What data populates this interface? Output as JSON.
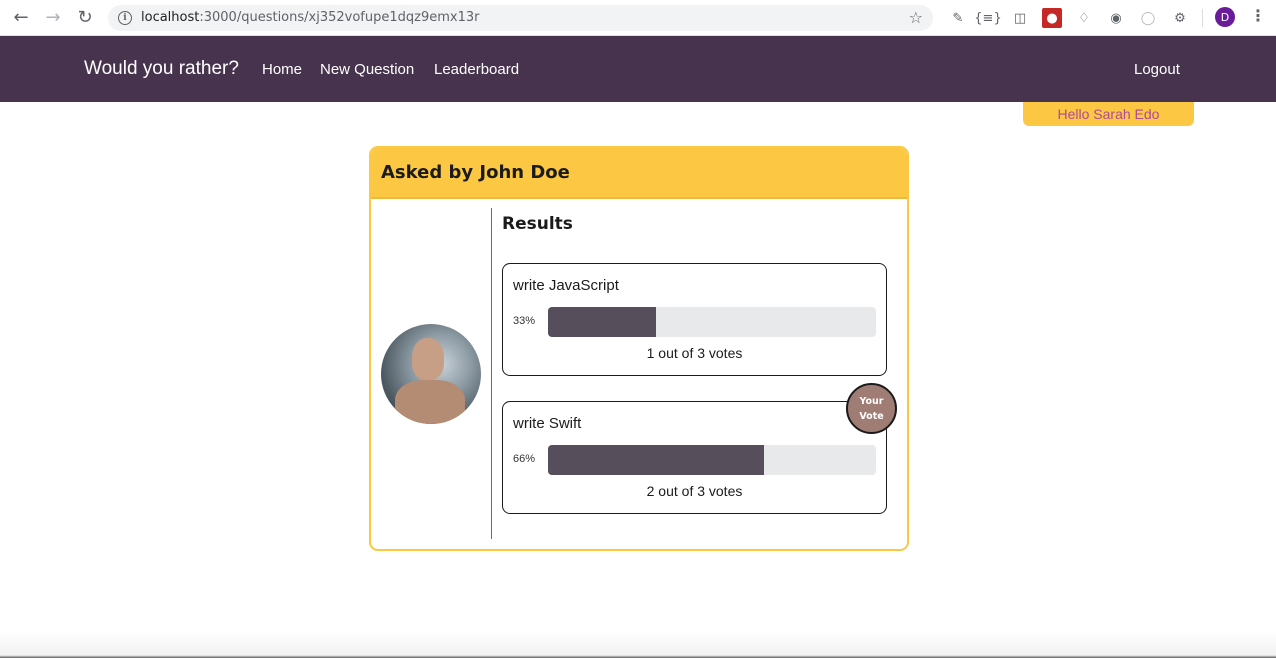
{
  "browser": {
    "url_host": "localhost",
    "url_path": ":3000/questions/xj352vofupe1dqz9emx13r",
    "profile_initial": "D"
  },
  "nav": {
    "brand": "Would you rather?",
    "home": "Home",
    "new_question": "New Question",
    "leaderboard": "Leaderboard",
    "logout": "Logout"
  },
  "greeting": "Hello Sarah Edo",
  "question": {
    "title": "Asked by John Doe",
    "results_label": "Results",
    "options": [
      {
        "text": "write JavaScript",
        "percent_label": "33%",
        "percent": 33,
        "votes_label": "1 out of 3 votes",
        "is_user_vote": false
      },
      {
        "text": "write Swift",
        "percent_label": "66%",
        "percent": 66,
        "votes_label": "2 out of 3 votes",
        "is_user_vote": true
      }
    ],
    "your_vote_label": "Your Vote"
  },
  "colors": {
    "navbar": "#47334d",
    "accent": "#fcc844",
    "greeting_text": "#b0489a",
    "bar_fill": "#564f5b",
    "bar_track": "#e7e9ea",
    "vote_badge": "#a07d74"
  }
}
